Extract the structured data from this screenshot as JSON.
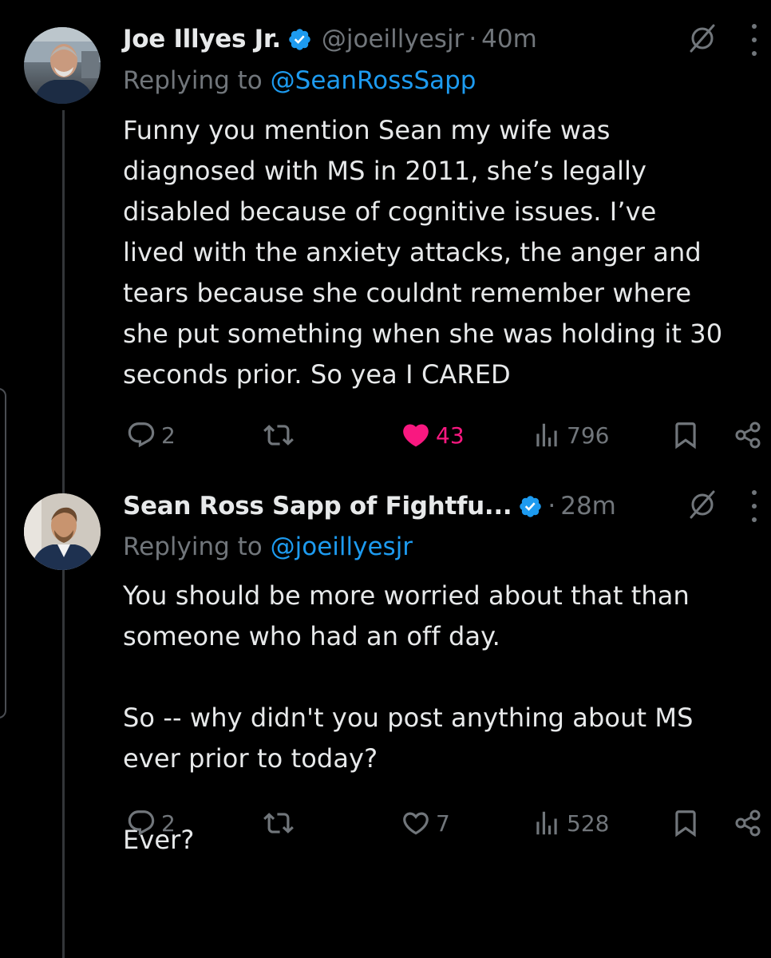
{
  "tweets": [
    {
      "author_name": "Joe Illyes Jr.",
      "handle": "@joeillyesjr",
      "separator": "·",
      "time": "40m",
      "replying_to_label": "Replying to",
      "replying_to_handle": "@SeanRossSapp",
      "text": "Funny you mention Sean my wife was\ndiagnosed with MS in 2011, she’s legally\ndisabled because of cognitive issues. I’ve\nlived with the anxiety attacks, the anger and\ntears because she couldnt remember where\nshe put something when she was holding it 30\nseconds prior. So yea I CARED",
      "replies": "2",
      "likes": "43",
      "liked": true,
      "views": "796"
    },
    {
      "author_name": "Sean Ross Sapp of Fightfu...",
      "handle": "",
      "separator": "·",
      "time": "28m",
      "replying_to_label": "Replying to",
      "replying_to_handle": "@joeillyesjr",
      "text": "You should be more worried about that than\nsomeone who had an off day.\n\nSo -- why didn't you post anything about MS\never prior to today?\n\nEver?",
      "replies": "2",
      "likes": "7",
      "liked": false,
      "views": "528"
    }
  ],
  "colors": {
    "background": "#000000",
    "text": "#e7e9ea",
    "muted": "#71767b",
    "link": "#1d9bf0",
    "like": "#f91880",
    "verified": "#1d9bf0"
  },
  "icons": [
    "reply-icon",
    "repost-icon",
    "like-icon",
    "views-icon",
    "bookmark-icon",
    "share-icon",
    "grok-icon",
    "more-icon",
    "verified-badge-icon"
  ]
}
